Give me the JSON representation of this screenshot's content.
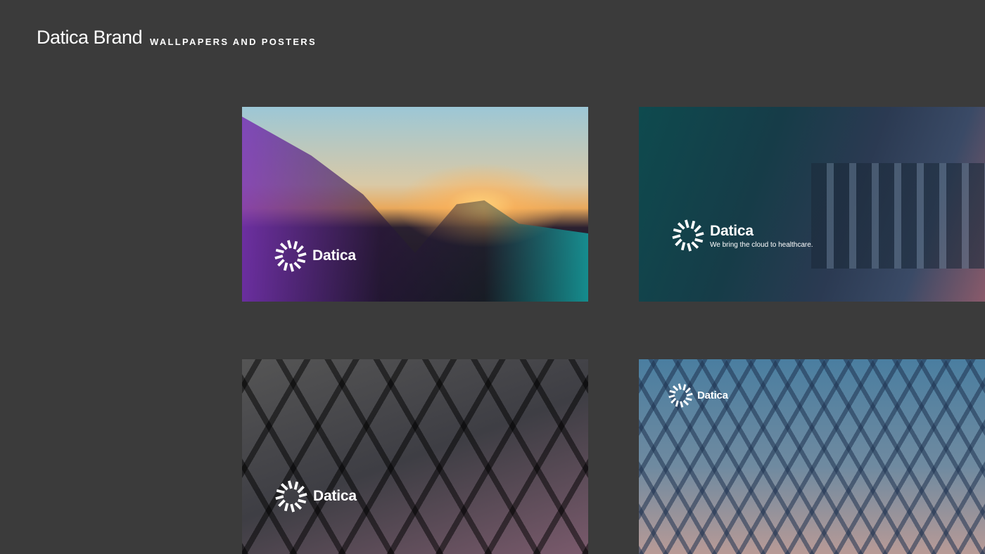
{
  "header": {
    "title": "Datica Brand",
    "subtitle": "WALLPAPERS AND POSTERS"
  },
  "cards": [
    {
      "name": "mountain-sunset-wallpaper",
      "brand": "Datica"
    },
    {
      "name": "healthcare-monitors-wallpaper",
      "brand": "Datica",
      "tagline": "We bring the cloud to healthcare."
    },
    {
      "name": "geometric-lattice-wallpaper",
      "brand": "Datica"
    },
    {
      "name": "triangular-corridor-wallpaper",
      "brand": "Datica"
    }
  ]
}
